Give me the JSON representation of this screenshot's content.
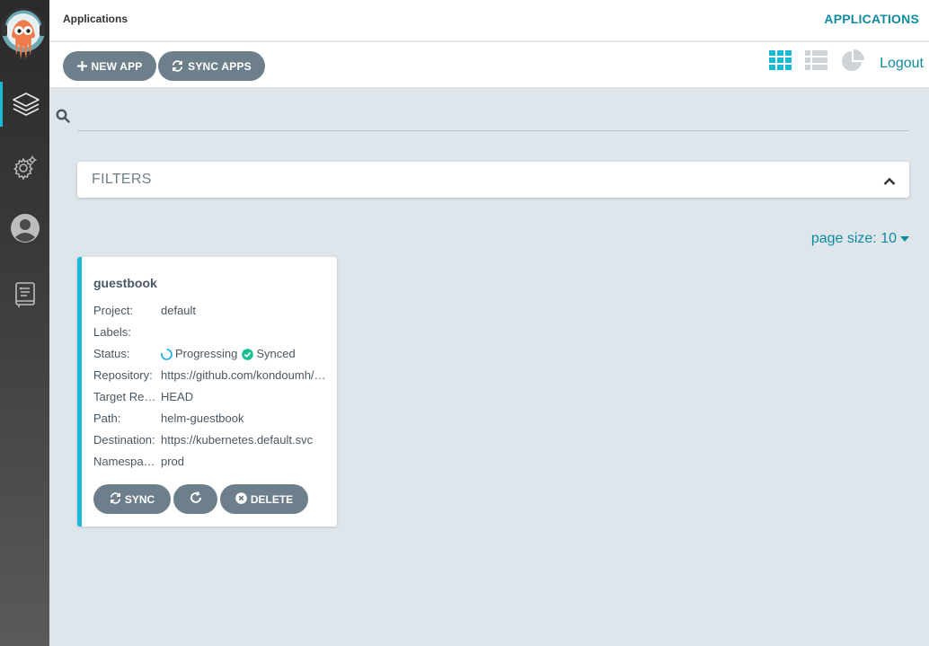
{
  "nav": {
    "items": [
      {
        "icon": "layers-icon"
      },
      {
        "icon": "gear-icon"
      },
      {
        "icon": "user-icon"
      },
      {
        "icon": "docs-icon"
      }
    ],
    "accent": "#18bbd6"
  },
  "header": {
    "title": "Applications",
    "right_title": "APPLICATIONS"
  },
  "toolbar": {
    "new_app_label": "NEW APP",
    "sync_apps_label": "SYNC APPS",
    "logout_label": "Logout",
    "views": [
      "tiles-view-icon",
      "list-view-icon",
      "pie-chart-icon"
    ],
    "active_view": "tiles"
  },
  "search": {
    "value": "",
    "placeholder": ""
  },
  "filters": {
    "label": "FILTERS",
    "expanded": false
  },
  "pagination": {
    "page_size_label": "page size: 10"
  },
  "apps": [
    {
      "name": "guestbook",
      "fields": [
        {
          "key": "Project:",
          "value": "default"
        },
        {
          "key": "Labels:",
          "value": ""
        },
        {
          "key": "Status:",
          "value": ""
        },
        {
          "key": "Repository:",
          "value": "https://github.com/kondoumh/argocd-example-apps"
        },
        {
          "key": "Target Revision:",
          "value": "HEAD"
        },
        {
          "key": "Path:",
          "value": "helm-guestbook"
        },
        {
          "key": "Destination:",
          "value": "https://kubernetes.default.svc"
        },
        {
          "key": "Namespace:",
          "value": "prod"
        }
      ],
      "health": "Progressing",
      "sync": "Synced",
      "actions": {
        "sync_label": "SYNC",
        "delete_label": "DELETE"
      }
    }
  ],
  "colors": {
    "primary_text": "#0f8ba0",
    "button_bg": "#6d7f8b",
    "synced": "#18be94",
    "progressing": "#0dadea"
  }
}
